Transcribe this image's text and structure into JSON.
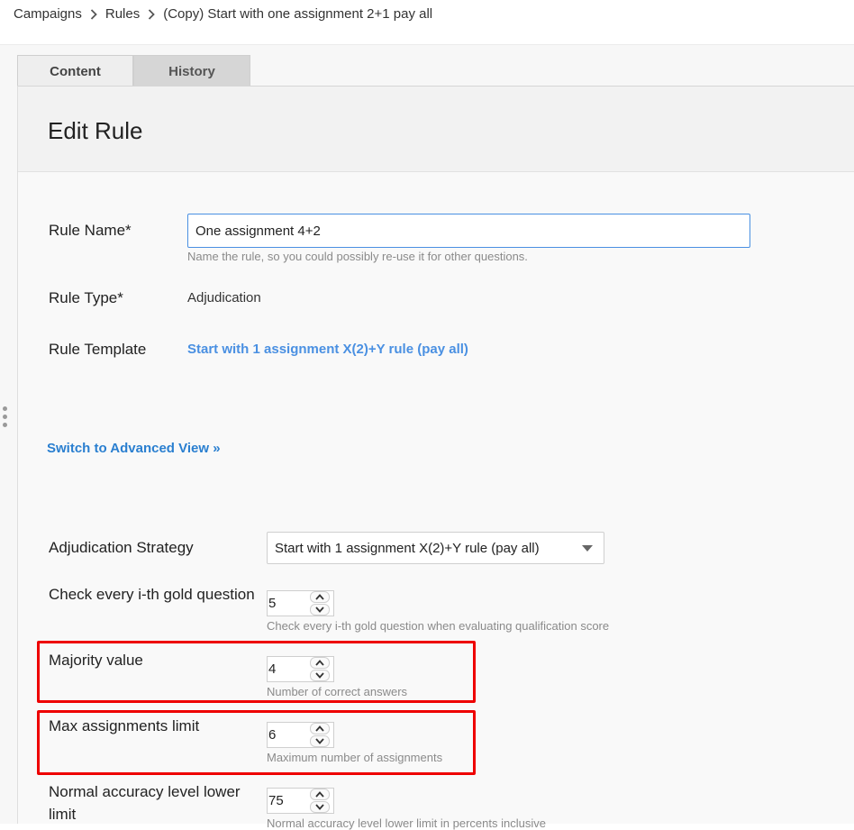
{
  "breadcrumb": {
    "items": [
      "Campaigns",
      "Rules",
      "(Copy) Start with one assignment 2+1 pay all"
    ]
  },
  "tabs": [
    {
      "label": "Content",
      "active": true
    },
    {
      "label": "History",
      "active": false
    }
  ],
  "panel": {
    "title": "Edit Rule"
  },
  "form": {
    "rule_name": {
      "label": "Rule Name*",
      "value": "One assignment 4+2",
      "hint": "Name the rule, so you could possibly re-use it for other questions."
    },
    "rule_type": {
      "label": "Rule Type*",
      "value": "Adjudication"
    },
    "rule_template": {
      "label": "Rule Template",
      "value": "Start with 1 assignment X(2)+Y rule (pay all)"
    },
    "advanced_link": "Switch to Advanced View »",
    "adjudication_strategy": {
      "label": "Adjudication Strategy",
      "value": "Start with 1 assignment X(2)+Y rule (pay all)"
    },
    "gold_check": {
      "label": "Check every i-th gold question",
      "value": "5",
      "hint": "Check every i-th gold question when evaluating qualification score"
    },
    "majority": {
      "label": "Majority value",
      "value": "4",
      "hint": "Number of correct answers"
    },
    "max_assignments": {
      "label": "Max assignments limit",
      "value": "6",
      "hint": "Maximum number of assignments"
    },
    "accuracy_lower": {
      "label_line1": "Normal accuracy level lower",
      "label_line2": "limit",
      "value": "75",
      "hint": "Normal accuracy level lower limit in percents inclusive"
    }
  },
  "colors": {
    "link": "#4a90e2",
    "highlight": "#ee0000",
    "input_border_focus": "#4a90e2"
  },
  "icons": [
    "chevron-right-icon",
    "caret-down-icon",
    "arrow-up-icon",
    "arrow-down-icon",
    "drag-handle-icon"
  ]
}
